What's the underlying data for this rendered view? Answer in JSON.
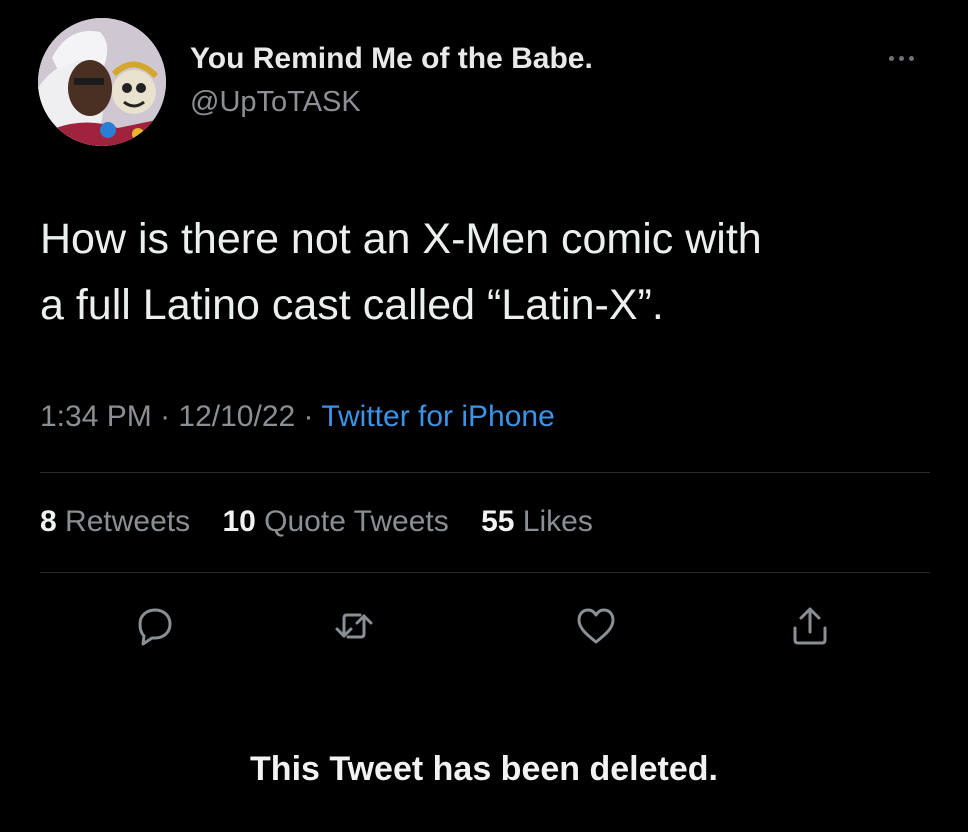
{
  "tweet": {
    "author": {
      "display_name": "You Remind Me of the Babe.",
      "handle": "@UpToTASK",
      "avatar_icon": "avatar"
    },
    "more_icon": "ellipsis-icon",
    "text_line1": "How is there not an X-Men comic with",
    "text_line2": "a full Latino cast called “Latin-X”.",
    "time": "1:34 PM",
    "date": "12/10/22",
    "separator": "·",
    "source": "Twitter for iPhone",
    "stats": {
      "retweets_count": "8",
      "retweets_label": "Retweets",
      "quote_count": "10",
      "quote_label": "Quote Tweets",
      "likes_count": "55",
      "likes_label": "Likes"
    },
    "actions": [
      "reply-icon",
      "retweet-icon",
      "like-icon",
      "share-icon"
    ]
  },
  "deleted_notice": "This Tweet has been deleted.",
  "colors": {
    "background": "#000000",
    "link": "#3a93e6",
    "secondary_text": "#8a8f94"
  }
}
